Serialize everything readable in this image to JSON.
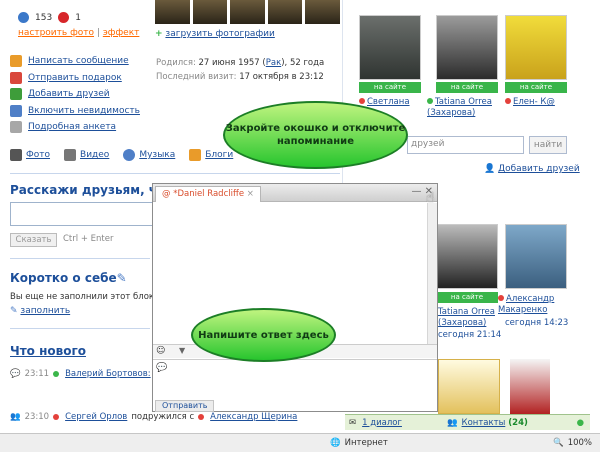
{
  "profile": {
    "rating_count": "153",
    "minus_count": "1",
    "set_photo": "настроить фото",
    "effect": "эффект",
    "actions": [
      "Написать сообщение",
      "Отправить подарок",
      "Добавить друзей",
      "Включить невидимость",
      "Подробная анкета"
    ],
    "upload_photos": "загрузить фотографии",
    "born_label": "Родился:",
    "born_value": "27 июня 1957 (",
    "zodiac": "Рак",
    "age": "), 52 года",
    "last_visit_label": "Последний визит:",
    "last_visit_value": "17 октября в 23:12"
  },
  "media": [
    "Фото",
    "Видео",
    "Музыка",
    "Блоги"
  ],
  "share": {
    "title": "Расскажи друзьям, что",
    "button": "Сказать",
    "hint": "Ctrl + Enter"
  },
  "about": {
    "title": "Коротко о себе",
    "empty": "Вы еще не заполнили этот блок.",
    "fill": "заполнить"
  },
  "news": {
    "title": "Что нового",
    "time1": "23:11",
    "author1": "Валерий Бортовов:",
    "time2": "23:10",
    "author2": "Сергей Орлов",
    "action2": "подружился с",
    "target2": "Александр Щерина"
  },
  "friends": {
    "onsite": "на сайте",
    "top": [
      {
        "name": "Светлана",
        "status": "red"
      },
      {
        "name": "Tatiana Orrea (Захарова)",
        "status": "green"
      },
      {
        "name": "Елен- К@",
        "status": "red"
      }
    ],
    "bottom": [
      {
        "name": "Tatiana Orrea (Захарова)",
        "time": "сегодня 21:14"
      },
      {
        "name": "Александр Макаренко",
        "time": "сегодня 14:23"
      }
    ],
    "search_placeholder": "друзей",
    "search_button": "найти",
    "add_friends": "Добавить друзей"
  },
  "chat": {
    "tab_name": "*Daniel Radcliffe",
    "send": "Отправить"
  },
  "callouts": {
    "top": "Закройте окошко и отключите напоминание",
    "bottom": "Напишите ответ здесь"
  },
  "chatbar": {
    "dialogs": "1 диалог",
    "contacts": "Контакты",
    "contacts_count": "(24)"
  },
  "statusbar": {
    "zone": "Интернет",
    "zoom": "100%"
  }
}
